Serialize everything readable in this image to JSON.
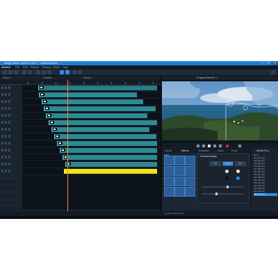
{
  "window": {
    "title": "Magix Movie Edit Pro 2017 - Untitled Movie - *",
    "minimize_icon": "minimize-icon",
    "maximize_icon": "maximize-icon",
    "close_icon": "close-icon"
  },
  "menubar": {
    "brand": "MAGIX",
    "items": [
      "File",
      "Edit",
      "Effects",
      "Window",
      "Share",
      "Help"
    ]
  },
  "left_tabs": [
    "Movie 1",
    "Timeline",
    "Movie 1"
  ],
  "preview": {
    "title": "Program Monitor 1"
  },
  "fx_panel": {
    "tabs": [
      "Import",
      "Effects",
      "Templates",
      "Audio",
      "Fonts"
    ],
    "active_tab": "Effects",
    "list_label": "Video",
    "props_title": "Chroma keying",
    "mode_buttons": [
      "Color",
      "Green",
      "Blue"
    ],
    "active_mode": "Green"
  },
  "browser": {
    "title": "Media Pool",
    "items": [
      "Movie",
      "Clip_001.mp4",
      "Clip_002.mp4",
      "Clip_003.mp4",
      "Clip_004.mp4",
      "Clip_005.mp4",
      "Clip_006.mp4",
      "Clip_007.mp4",
      "Clip_008.mp4",
      "Clip_009.mp4",
      "Clip_010.mp4",
      "Clip_011.mp4",
      "Clip_012.mp4",
      "Clip_013.mp4",
      "Clip_014.mp4"
    ],
    "selected_index": 14
  },
  "statusbar": {
    "text": "Duration 00:02:37:14"
  },
  "colors": {
    "titlebar": "#1f7fd6",
    "clip_teal": "#2e8a93",
    "clip_yellow": "#efe11a",
    "playhead": "#ff8a2a",
    "accent": "#2a8ee8"
  }
}
